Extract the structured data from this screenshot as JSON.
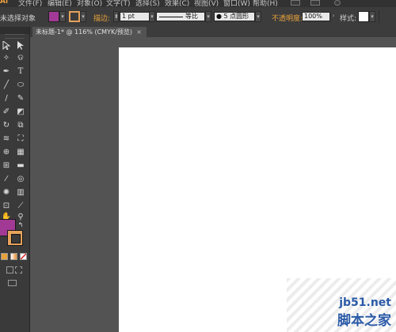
{
  "menubar": {
    "logo": "Ai",
    "items": [
      "文件(F)",
      "编辑(E)",
      "对象(O)",
      "文字(T)",
      "选择(S)",
      "效果(C)",
      "视图(V)",
      "窗口(W)",
      "帮助(H)"
    ]
  },
  "controlbar": {
    "selection_status": "未选择对象",
    "fill_color": "#a23a95",
    "stroke_color": "#e5a35c",
    "stroke_label": "描边:",
    "stroke_weight": "1 pt",
    "profile_label": "等比",
    "brush_label": "5 点圆形",
    "opacity_label": "不透明度:",
    "opacity_value": "100%",
    "style_label": "样式:"
  },
  "document": {
    "tab_title": "未标题-1* @ 116% (CMYK/预览)",
    "tab_close": "×"
  },
  "tools": [
    "selection-tool",
    "direct-selection-tool",
    "magic-wand-tool",
    "lasso-tool",
    "pen-tool",
    "type-tool",
    "line-tool",
    "ellipse-tool",
    "paintbrush-tool",
    "pencil-tool",
    "blob-brush-tool",
    "eraser-tool",
    "rotate-tool",
    "scale-tool",
    "width-tool",
    "free-transform-tool",
    "shape-builder-tool",
    "perspective-grid-tool",
    "mesh-tool",
    "gradient-tool",
    "eyedropper-tool",
    "blend-tool",
    "symbol-sprayer-tool",
    "column-graph-tool",
    "artboard-tool",
    "slice-tool",
    "hand-tool",
    "zoom-tool"
  ],
  "colors": {
    "fill": "#a23a95",
    "stroke": "#e5a35c",
    "accent_orange": "#e9a23b"
  },
  "watermark": {
    "url": "jb51.net",
    "name": "脚本之家"
  }
}
